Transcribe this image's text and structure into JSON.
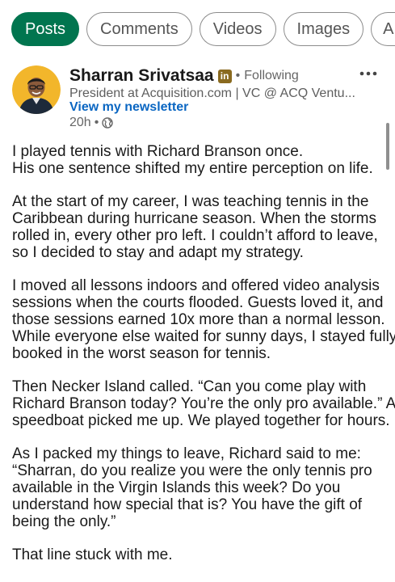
{
  "tabs": [
    {
      "label": "Posts",
      "active": true
    },
    {
      "label": "Comments",
      "active": false
    },
    {
      "label": "Videos",
      "active": false
    },
    {
      "label": "Images",
      "active": false
    },
    {
      "label": "A",
      "active": false
    }
  ],
  "colors": {
    "accent_green": "#01754f",
    "link_blue": "#0a66c2",
    "avatar_bg": "#f2b62b"
  },
  "post": {
    "author": {
      "name": "Sharran Srivatsaa",
      "badge": "in",
      "separator": "•",
      "follow_status": "Following",
      "headline": "President at Acquisition.com | VC @ ACQ Ventu...",
      "newsletter_link": "View my newsletter",
      "time": "20h",
      "time_separator": "•",
      "visibility_icon": "globe-icon"
    },
    "more_icon": "more-horizontal-icon",
    "paragraphs": [
      [
        "I played tennis with Richard Branson once.",
        "His one sentence shifted my entire perception on life."
      ],
      [
        "At the start of my career, I was teaching tennis in the",
        "Caribbean during hurricane season. When the storms",
        "rolled in, every other pro left. I couldn’t afford to leave,",
        "so I decided to stay and adapt my strategy."
      ],
      [
        "I moved all lessons indoors and offered video analysis",
        "sessions when the courts flooded. Guests loved it, and",
        "those sessions earned 10x more than a normal lesson.",
        "While everyone else waited for sunny days, I stayed fully",
        "booked in the worst season for tennis."
      ],
      [
        "Then Necker Island called. “Can you come play with",
        "Richard Branson today? You’re the only pro available.” A",
        "speedboat picked me up. We played together for hours."
      ],
      [
        "As I packed my things to leave, Richard said to me:",
        "“Sharran, do you realize you were the only tennis pro",
        "available in the Virgin Islands this week? Do you",
        "understand how special that is? You have the gift of",
        "being the only.”"
      ],
      [
        "That line stuck with me."
      ]
    ]
  }
}
